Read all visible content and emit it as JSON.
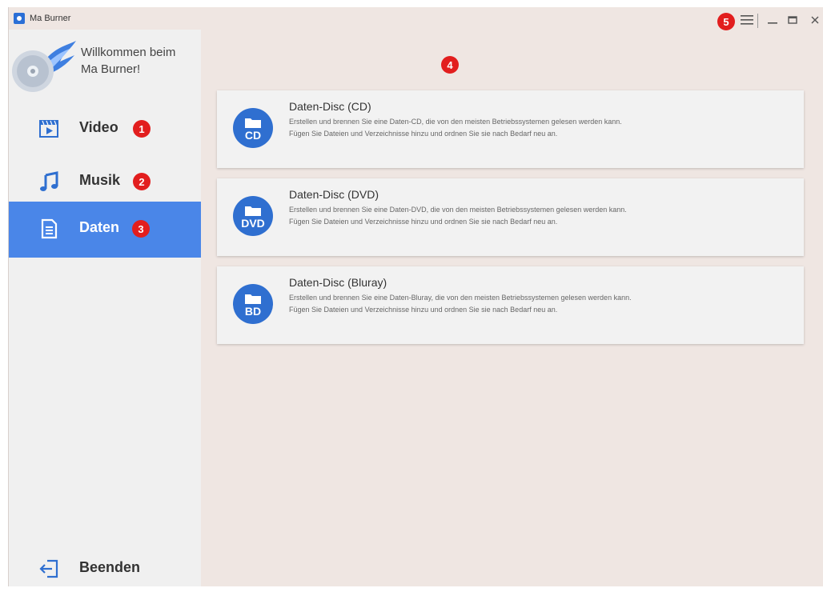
{
  "window": {
    "title": "Ma Burner",
    "menu_badge": "5",
    "main_badge": "4"
  },
  "sidebar": {
    "welcome": [
      "Willkommen beim",
      "Ma Burner!"
    ],
    "items": [
      {
        "label": "Video",
        "badge": "1",
        "icon": "video-icon"
      },
      {
        "label": "Musik",
        "badge": "2",
        "icon": "music-note-icon"
      },
      {
        "label": "Daten",
        "badge": "3",
        "icon": "document-icon",
        "active": true
      }
    ],
    "exit": {
      "label": "Beenden",
      "icon": "exit-icon"
    }
  },
  "cards": [
    {
      "title": "Daten-Disc (CD)",
      "tag": "CD",
      "line1": "Erstellen und brennen Sie eine Daten-CD, die von den meisten Betriebssystemen gelesen werden kann.",
      "line2": "Fügen Sie Dateien und Verzeichnisse hinzu und ordnen Sie sie nach Bedarf neu an."
    },
    {
      "title": "Daten-Disc (DVD)",
      "tag": "DVD",
      "line1": "Erstellen und brennen Sie eine Daten-DVD, die von den meisten Betriebssystemen gelesen werden kann.",
      "line2": "Fügen Sie Dateien und Verzeichnisse hinzu und ordnen Sie sie nach Bedarf neu an."
    },
    {
      "title": "Daten-Disc (Bluray)",
      "tag": "BD",
      "line1": "Erstellen und brennen Sie eine Daten-Bluray, die von den meisten Betriebssystemen gelesen werden kann.",
      "line2": "Fügen Sie Dateien und Verzeichnisse hinzu und ordnen Sie sie nach Bedarf neu an."
    }
  ],
  "colors": {
    "accent": "#4a86e8",
    "badge": "#e21e1e",
    "disc": "#2f6fd0"
  }
}
